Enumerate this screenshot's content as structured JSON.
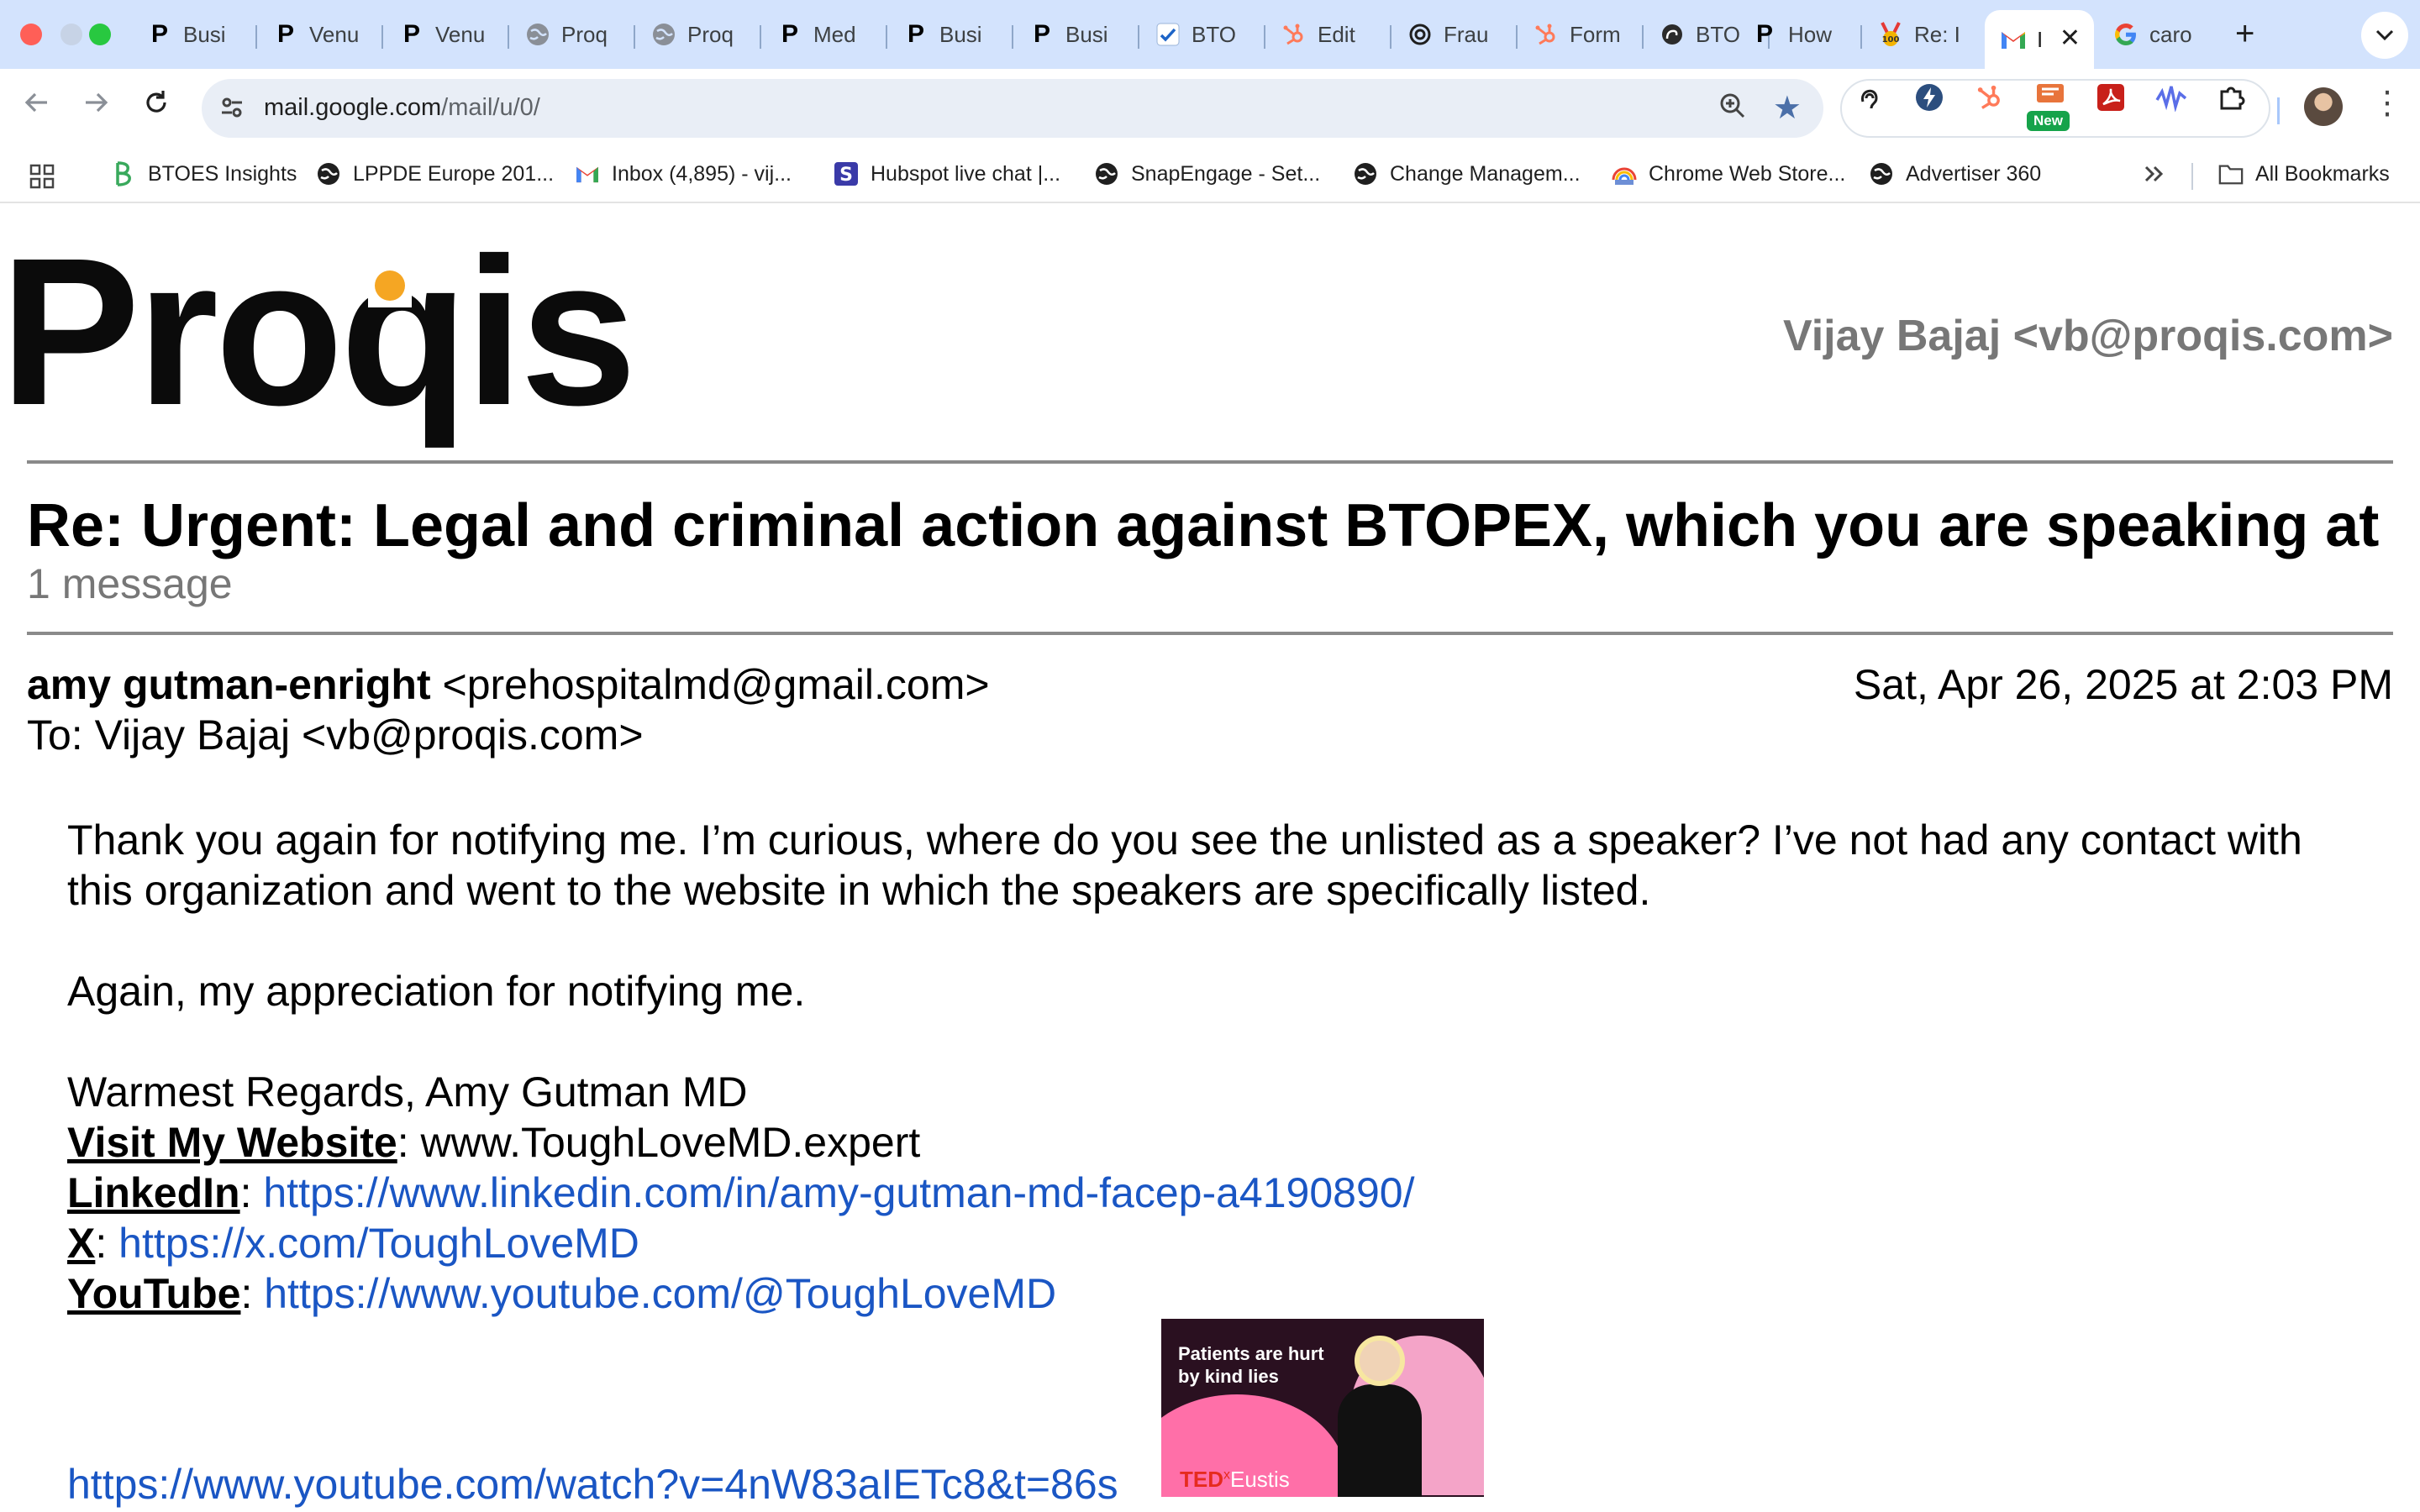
{
  "tabs": [
    {
      "label": "Busi",
      "icon": "P"
    },
    {
      "label": "Venu",
      "icon": "P"
    },
    {
      "label": "Venu",
      "icon": "P"
    },
    {
      "label": "Proq",
      "icon": "globe"
    },
    {
      "label": "Proq",
      "icon": "globe"
    },
    {
      "label": "Med",
      "icon": "P"
    },
    {
      "label": "Busi",
      "icon": "P"
    },
    {
      "label": "Busi",
      "icon": "P"
    },
    {
      "label": "BTO",
      "icon": "check"
    },
    {
      "label": "Edit",
      "icon": "hubspot"
    },
    {
      "label": "Frau",
      "icon": "openai"
    },
    {
      "label": "Form",
      "icon": "hubspot"
    },
    {
      "label": "BTO",
      "icon": "circle"
    },
    {
      "label": "How",
      "icon": "P"
    },
    {
      "label": "Re: I",
      "icon": "medal"
    },
    {
      "label": "I",
      "icon": "gmail"
    },
    {
      "label": "caro",
      "icon": "google"
    }
  ],
  "active_tab_index": 15,
  "toolbar": {
    "url_domain": "mail.google.com",
    "url_path": "/mail/u/0/",
    "new_badge": "New"
  },
  "bookmarks": [
    {
      "label": "BTOES Insights",
      "icon": "btoes"
    },
    {
      "label": "LPPDE Europe 201...",
      "icon": "globe"
    },
    {
      "label": "Inbox (4,895) - vij...",
      "icon": "gmail"
    },
    {
      "label": "Hubspot live chat |...",
      "icon": "s-box"
    },
    {
      "label": "SnapEngage - Set...",
      "icon": "globe"
    },
    {
      "label": "Change Managem...",
      "icon": "globe"
    },
    {
      "label": "Chrome Web Store...",
      "icon": "rainbow"
    },
    {
      "label": "Advertiser 360",
      "icon": "globe"
    }
  ],
  "all_bookmarks_label": "All Bookmarks",
  "email": {
    "logo_text": "Proqis",
    "account": "Vijay Bajaj <vb@proqis.com>",
    "subject": "Re: Urgent: Legal and criminal action against BTOPEX, which you are speaking at",
    "message_count": "1 message",
    "sender_name": "amy gutman-enright",
    "sender_email": "<prehospitalmd@gmail.com>",
    "date": "Sat, Apr 26, 2025 at 2:03 PM",
    "to": "To: Vijay Bajaj <vb@proqis.com>",
    "para1": "Thank you again for notifying me. I’m curious, where do you see the unlisted as a speaker? I’ve not had any contact with this organization and went to the website in which the speakers are specifically listed.",
    "para2": "Again, my appreciation for notifying me.",
    "signoff": "Warmest Regards, Amy Gutman MD",
    "website_label": "Visit My Website",
    "website_value": ": www.ToughLoveMD.expert",
    "linkedin_label": "LinkedIn",
    "linkedin_url": "https://www.linkedin.com/in/amy-gutman-md-facep-a4190890/",
    "x_label": "X",
    "x_url": "https://x.com/ToughLoveMD",
    "youtube_label": "YouTube",
    "youtube_url": "https://www.youtube.com/@ToughLoveMD",
    "video_url": "https://www.youtube.com/watch?v=4nW83aIETc8&t=86s",
    "thumb_caption_1": "Patients are hurt",
    "thumb_caption_2": "by kind lies",
    "thumb_ted": "TED",
    "thumb_x": "x",
    "thumb_event": "Eustis"
  }
}
